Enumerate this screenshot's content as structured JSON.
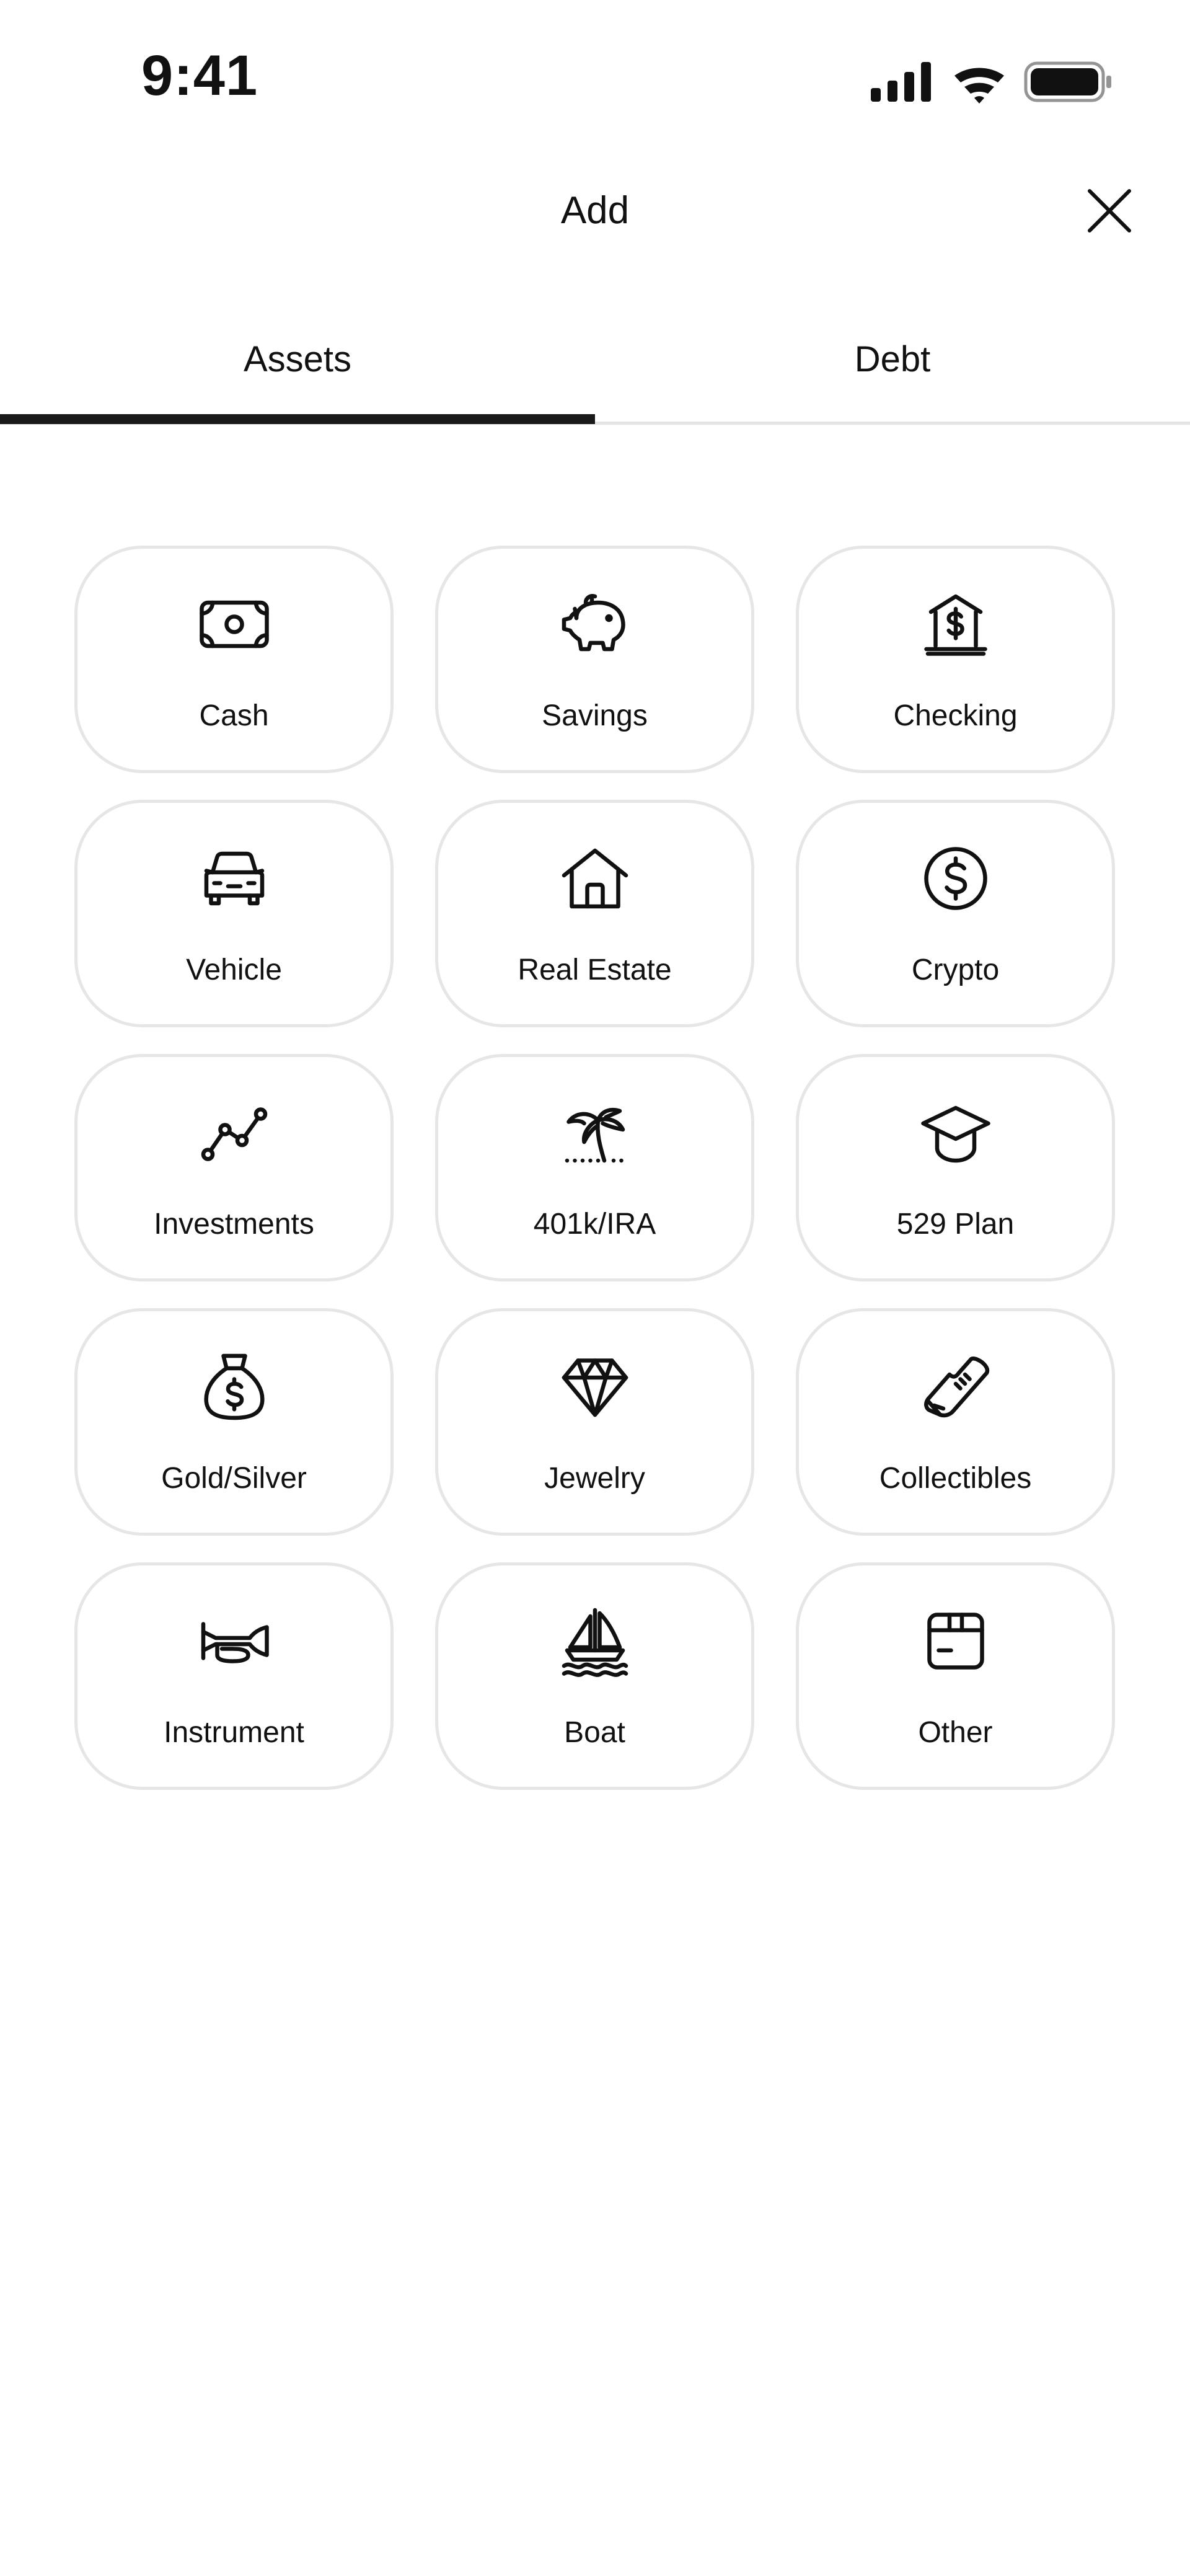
{
  "status_bar": {
    "time": "9:41",
    "icons": [
      "cellular-signal-icon",
      "wifi-icon",
      "battery-icon"
    ]
  },
  "header": {
    "title": "Add",
    "close_icon": "close-icon"
  },
  "tabs": [
    {
      "label": "Assets",
      "selected": true
    },
    {
      "label": "Debt",
      "selected": false
    }
  ],
  "assets": [
    {
      "label": "Cash",
      "icon": "cash-icon"
    },
    {
      "label": "Savings",
      "icon": "piggy-bank-icon"
    },
    {
      "label": "Checking",
      "icon": "bank-icon"
    },
    {
      "label": "Vehicle",
      "icon": "car-icon"
    },
    {
      "label": "Real Estate",
      "icon": "house-icon"
    },
    {
      "label": "Crypto",
      "icon": "dollar-coin-icon"
    },
    {
      "label": "Investments",
      "icon": "line-chart-icon"
    },
    {
      "label": "401k/IRA",
      "icon": "palm-tree-icon"
    },
    {
      "label": "529 Plan",
      "icon": "graduation-cap-icon"
    },
    {
      "label": "Gold/Silver",
      "icon": "money-bag-icon"
    },
    {
      "label": "Jewelry",
      "icon": "diamond-icon"
    },
    {
      "label": "Collectibles",
      "icon": "sneaker-icon"
    },
    {
      "label": "Instrument",
      "icon": "trumpet-icon"
    },
    {
      "label": "Boat",
      "icon": "sailboat-icon"
    },
    {
      "label": "Other",
      "icon": "box-icon"
    }
  ],
  "colors": {
    "text": "#111111",
    "tile_border": "#e6e6e6",
    "tab_indicator": "#1a1a1a",
    "divider": "#e4e4e4"
  }
}
